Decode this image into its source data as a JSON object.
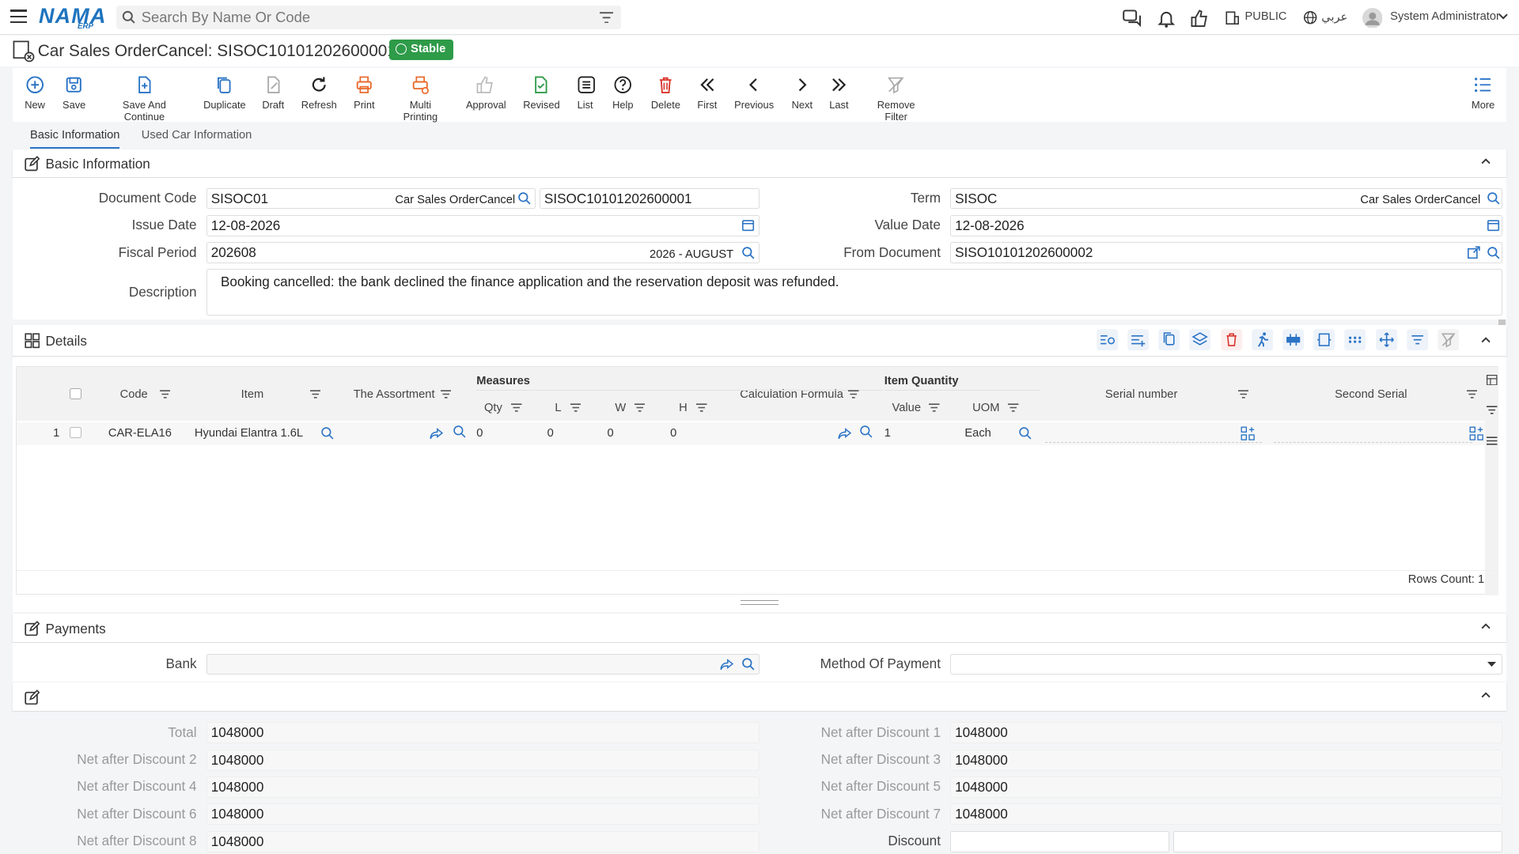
{
  "app": {
    "logo": "NAMA",
    "logo_sub": "ERP",
    "search_placeholder": "Search By Name Or Code",
    "public_label": "PUBLIC",
    "lang_label": "عربي",
    "user": "System Administrator"
  },
  "page": {
    "title": "Car Sales OrderCancel: SISOC10101202600001",
    "status": "Stable"
  },
  "toolbar": [
    "New",
    "Save",
    "Save And Continue",
    "Duplicate",
    "Draft",
    "Refresh",
    "Print",
    "Multi Printing",
    "Approval",
    "Revised",
    "List",
    "Help",
    "Delete",
    "First",
    "Previous",
    "Next",
    "Last",
    "Remove Filter",
    "More"
  ],
  "tabs": [
    "Basic Information",
    "Used Car Information"
  ],
  "basic": {
    "section_title": "Basic Information",
    "document_code_label": "Document Code",
    "document_code": "SISOC01",
    "document_code_type": "Car Sales OrderCancel",
    "document_number": "SISOC10101202600001",
    "term_label": "Term",
    "term": "SISOC",
    "term_type": "Car Sales OrderCancel",
    "issue_date_label": "Issue Date",
    "issue_date": "12-08-2026",
    "value_date_label": "Value Date",
    "value_date": "12-08-2026",
    "fiscal_period_label": "Fiscal Period",
    "fiscal_period": "202608",
    "fiscal_period_name": "2026 - AUGUST",
    "from_document_label": "From Document",
    "from_document": "SISO10101202600002",
    "description_label": "Description",
    "description": "Booking cancelled: the bank declined the finance application and the reservation deposit was refunded."
  },
  "details": {
    "section_title": "Details",
    "columns": {
      "code": "Code",
      "item": "Item",
      "assortment": "The Assortment",
      "measures": "Measures",
      "qty": "Qty",
      "l": "L",
      "w": "W",
      "h": "H",
      "calc": "Calculation Formula",
      "item_quantity": "Item Quantity",
      "value": "Value",
      "uom": "UOM",
      "serial": "Serial number",
      "second_serial": "Second Serial"
    },
    "rows": [
      {
        "num": "1",
        "code": "CAR-ELA16",
        "item": "Hyundai Elantra 1.6L",
        "qty": "0",
        "l": "0",
        "w": "0",
        "h": "0",
        "value": "1",
        "uom": "Each"
      }
    ],
    "rows_count": "Rows Count: 1"
  },
  "payments": {
    "section_title": "Payments",
    "bank_label": "Bank",
    "bank": "",
    "method_label": "Method Of Payment",
    "method": ""
  },
  "totals": {
    "total_label": "Total",
    "total": "1048000",
    "nad1_label": "Net after Discount 1",
    "nad1": "1048000",
    "nad2_label": "Net after Discount 2",
    "nad2": "1048000",
    "nad3_label": "Net after Discount 3",
    "nad3": "1048000",
    "nad4_label": "Net after Discount 4",
    "nad4": "1048000",
    "nad5_label": "Net after Discount 5",
    "nad5": "1048000",
    "nad6_label": "Net after Discount 6",
    "nad6": "1048000",
    "nad7_label": "Net after Discount 7",
    "nad7": "1048000",
    "nad8_label": "Net after Discount 8",
    "nad8": "1048000",
    "discount_label": "Discount",
    "discount": ""
  },
  "colors": {
    "accent": "#2a73c5",
    "stable": "#2e9b49",
    "delete": "#d9342b",
    "print": "#e8692a"
  }
}
